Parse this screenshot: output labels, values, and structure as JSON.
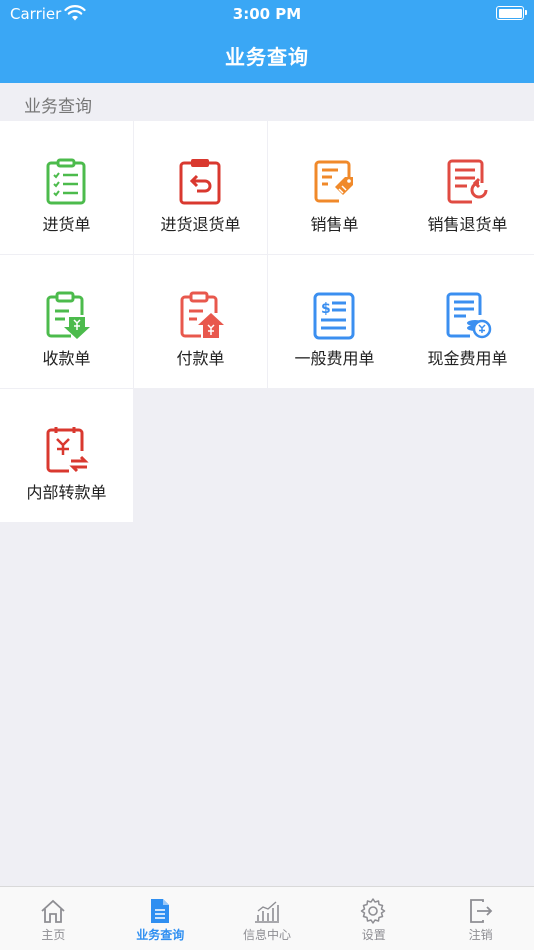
{
  "status_bar": {
    "carrier": "Carrier",
    "time": "3:00 PM"
  },
  "navbar": {
    "title": "业务查询"
  },
  "section": {
    "title": "业务查询"
  },
  "grid": {
    "items": [
      {
        "label": "进货单",
        "icon": "purchase-order-icon",
        "color": "#4cbb4c"
      },
      {
        "label": "进货退货单",
        "icon": "purchase-return-icon",
        "color": "#d9382f"
      },
      {
        "label": "销售单",
        "icon": "sales-order-icon",
        "color": "#f0892a"
      },
      {
        "label": "销售退货单",
        "icon": "sales-return-icon",
        "color": "#e04b42"
      },
      {
        "label": "收款单",
        "icon": "receipt-icon",
        "color": "#4cbb4c"
      },
      {
        "label": "付款单",
        "icon": "payment-icon",
        "color": "#e8584d"
      },
      {
        "label": "一般费用单",
        "icon": "general-expense-icon",
        "color": "#3b8ff0"
      },
      {
        "label": "现金费用单",
        "icon": "cash-expense-icon",
        "color": "#3b8ff0"
      },
      {
        "label": "内部转款单",
        "icon": "internal-transfer-icon",
        "color": "#d9382f"
      }
    ]
  },
  "tabbar": {
    "items": [
      {
        "label": "主页",
        "icon": "home-icon",
        "active": false
      },
      {
        "label": "业务查询",
        "icon": "document-icon",
        "active": true
      },
      {
        "label": "信息中心",
        "icon": "chart-icon",
        "active": false
      },
      {
        "label": "设置",
        "icon": "gear-icon",
        "active": false
      },
      {
        "label": "注销",
        "icon": "logout-icon",
        "active": false
      }
    ]
  },
  "colors": {
    "primary": "#3aa7f5",
    "tab_active": "#2f8ff1",
    "tab_inactive": "#8e8e93",
    "background": "#efeff4"
  }
}
